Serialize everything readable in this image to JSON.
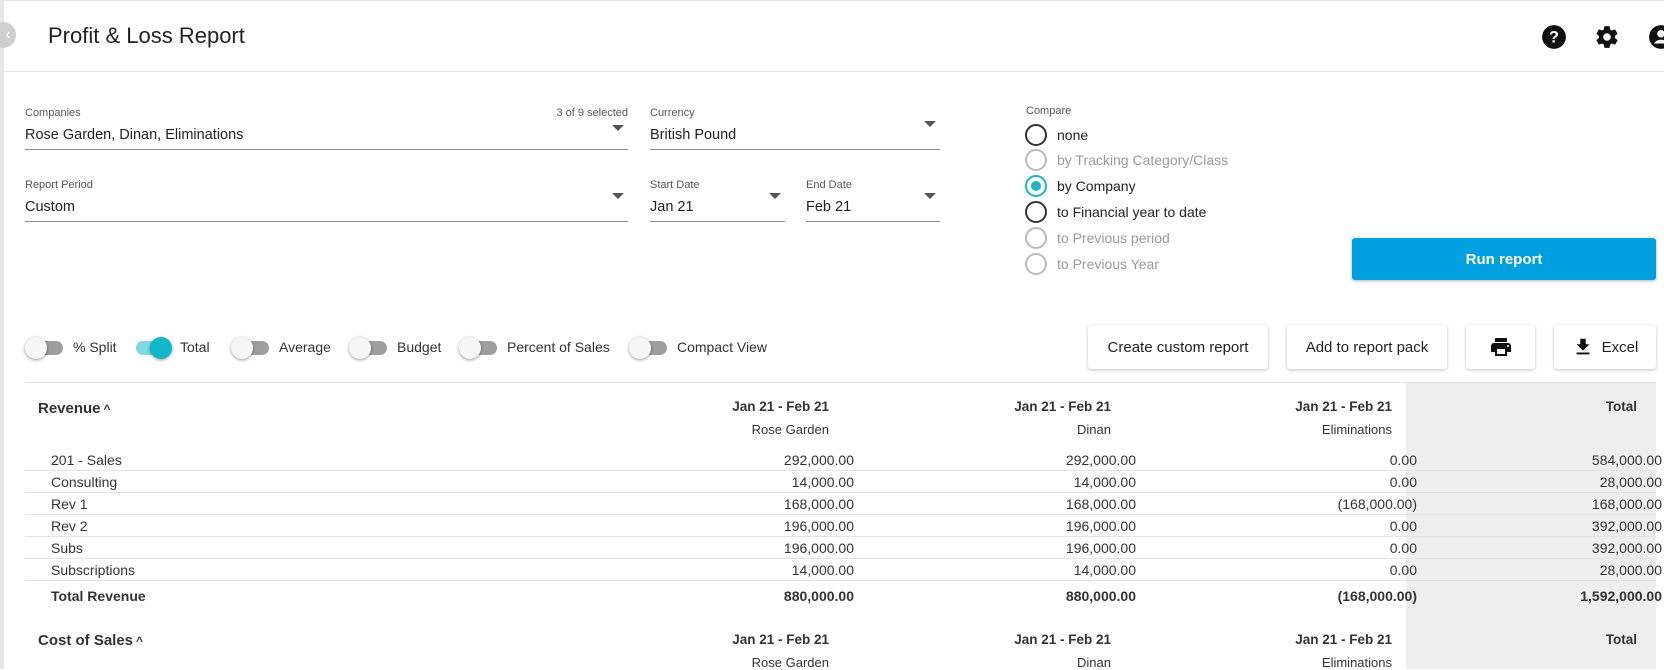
{
  "header": {
    "title": "Profit & Loss Report",
    "icons": [
      "back-icon",
      "help-icon",
      "settings-icon",
      "account-icon"
    ]
  },
  "filters": {
    "companies": {
      "label": "Companies",
      "value": "Rose Garden, Dinan, Eliminations",
      "extra": "3 of 9 selected"
    },
    "currency": {
      "label": "Currency",
      "value": "British Pound"
    },
    "report_period": {
      "label": "Report Period",
      "value": "Custom"
    },
    "start_date": {
      "label": "Start Date",
      "value": "Jan 21"
    },
    "end_date": {
      "label": "End Date",
      "value": "Feb 21"
    }
  },
  "compare": {
    "label": "Compare",
    "options": [
      {
        "label": "none",
        "state": "enabled"
      },
      {
        "label": "by Tracking Category/Class",
        "state": "disabled"
      },
      {
        "label": "by Company",
        "state": "checked"
      },
      {
        "label": "to Financial year to date",
        "state": "enabled"
      },
      {
        "label": "to Previous period",
        "state": "disabled"
      },
      {
        "label": "to Previous Year",
        "state": "disabled"
      }
    ]
  },
  "run_button": "Run report",
  "toggles": [
    {
      "label": "% Split",
      "on": false
    },
    {
      "label": "Total",
      "on": true
    },
    {
      "label": "Average",
      "on": false
    },
    {
      "label": "Budget",
      "on": false
    },
    {
      "label": "Percent of Sales",
      "on": false
    },
    {
      "label": "Compact View",
      "on": false
    }
  ],
  "actions": {
    "create_custom": "Create custom report",
    "add_pack": "Add to report pack",
    "excel": "Excel"
  },
  "table": {
    "columns": [
      {
        "period": "Jan 21 - Feb 21",
        "entity": "Rose Garden"
      },
      {
        "period": "Jan 21 - Feb 21",
        "entity": "Dinan"
      },
      {
        "period": "Jan 21 - Feb 21",
        "entity": "Eliminations"
      },
      {
        "period": "Total",
        "entity": ""
      }
    ],
    "revenue": {
      "title": "Revenue",
      "rows": [
        {
          "name": "201 - Sales",
          "values": [
            "292,000.00",
            "292,000.00",
            "0.00",
            "584,000.00"
          ]
        },
        {
          "name": "Consulting",
          "values": [
            "14,000.00",
            "14,000.00",
            "0.00",
            "28,000.00"
          ]
        },
        {
          "name": "Rev 1",
          "values": [
            "168,000.00",
            "168,000.00",
            "(168,000.00)",
            "168,000.00"
          ]
        },
        {
          "name": "Rev 2",
          "values": [
            "196,000.00",
            "196,000.00",
            "0.00",
            "392,000.00"
          ]
        },
        {
          "name": "Subs",
          "values": [
            "196,000.00",
            "196,000.00",
            "0.00",
            "392,000.00"
          ]
        },
        {
          "name": "Subscriptions",
          "values": [
            "14,000.00",
            "14,000.00",
            "0.00",
            "28,000.00"
          ]
        }
      ],
      "total": {
        "name": "Total Revenue",
        "values": [
          "880,000.00",
          "880,000.00",
          "(168,000.00)",
          "1,592,000.00"
        ]
      }
    },
    "cost_of_sales": {
      "title": "Cost of Sales"
    }
  },
  "colors": {
    "accent": "#009fe0",
    "toggle_on": "#10b6cc",
    "radio_checked": "#1cb4c8"
  }
}
